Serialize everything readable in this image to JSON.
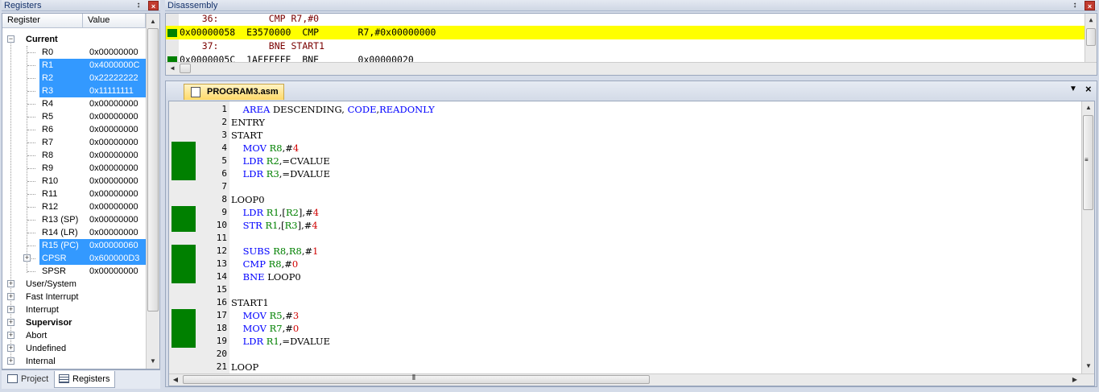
{
  "registers_panel": {
    "title": "Registers",
    "columns": [
      "Register",
      "Value"
    ],
    "current_label": "Current",
    "rows": [
      {
        "name": "R0",
        "value": "0x00000000",
        "selected": false
      },
      {
        "name": "R1",
        "value": "0x4000000C",
        "selected": true
      },
      {
        "name": "R2",
        "value": "0x22222222",
        "selected": true
      },
      {
        "name": "R3",
        "value": "0x11111111",
        "selected": true
      },
      {
        "name": "R4",
        "value": "0x00000000",
        "selected": false
      },
      {
        "name": "R5",
        "value": "0x00000000",
        "selected": false
      },
      {
        "name": "R6",
        "value": "0x00000000",
        "selected": false
      },
      {
        "name": "R7",
        "value": "0x00000000",
        "selected": false
      },
      {
        "name": "R8",
        "value": "0x00000000",
        "selected": false
      },
      {
        "name": "R9",
        "value": "0x00000000",
        "selected": false
      },
      {
        "name": "R10",
        "value": "0x00000000",
        "selected": false
      },
      {
        "name": "R11",
        "value": "0x00000000",
        "selected": false
      },
      {
        "name": "R12",
        "value": "0x00000000",
        "selected": false
      },
      {
        "name": "R13 (SP)",
        "value": "0x00000000",
        "selected": false
      },
      {
        "name": "R14 (LR)",
        "value": "0x00000000",
        "selected": false
      },
      {
        "name": "R15 (PC)",
        "value": "0x00000060",
        "selected": true
      },
      {
        "name": "CPSR",
        "value": "0x600000D3",
        "selected": true
      },
      {
        "name": "SPSR",
        "value": "0x00000000",
        "selected": false
      }
    ],
    "groups": [
      {
        "name": "User/System",
        "bold": false
      },
      {
        "name": "Fast Interrupt",
        "bold": false
      },
      {
        "name": "Interrupt",
        "bold": false
      },
      {
        "name": "Supervisor",
        "bold": true
      },
      {
        "name": "Abort",
        "bold": false
      },
      {
        "name": "Undefined",
        "bold": false
      },
      {
        "name": "Internal",
        "bold": false
      }
    ]
  },
  "bottom_tabs": [
    {
      "label": "Project",
      "active": false
    },
    {
      "label": "Registers",
      "active": true
    }
  ],
  "disassembly": {
    "title": "Disassembly",
    "lines": [
      {
        "text": "    36:         CMP R7,#0",
        "highlight": false,
        "marker": false
      },
      {
        "text": "0x00000058  E3570000  CMP       R7,#0x00000000",
        "highlight": true,
        "marker": true
      },
      {
        "text": "    37:         BNE START1",
        "highlight": false,
        "marker": false
      },
      {
        "text": "0x0000005C  1AFFFFFE  BNE       0x00000020",
        "highlight": false,
        "marker": true
      }
    ]
  },
  "editor": {
    "tab_label": "PROGRAM3.asm",
    "lines": [
      {
        "n": "1",
        "bp": false,
        "code": [
          [
            "    ",
            ""
          ],
          [
            "AREA",
            "kw"
          ],
          [
            " DESCENDING, ",
            ""
          ],
          [
            "CODE",
            "kw"
          ],
          [
            ",",
            ""
          ],
          [
            "READONLY",
            "kw"
          ]
        ]
      },
      {
        "n": "2",
        "bp": false,
        "code": [
          [
            "ENTRY",
            ""
          ]
        ]
      },
      {
        "n": "3",
        "bp": false,
        "code": [
          [
            "START",
            ""
          ]
        ]
      },
      {
        "n": "4",
        "bp": true,
        "code": [
          [
            "    ",
            ""
          ],
          [
            "MOV",
            "kw"
          ],
          [
            " ",
            ""
          ],
          [
            "R8",
            "reg"
          ],
          [
            ",#",
            ""
          ],
          [
            "4",
            "num"
          ]
        ]
      },
      {
        "n": "5",
        "bp": true,
        "code": [
          [
            "    ",
            ""
          ],
          [
            "LDR",
            "kw"
          ],
          [
            " ",
            ""
          ],
          [
            "R2",
            "reg"
          ],
          [
            ",=CVALUE",
            ""
          ]
        ]
      },
      {
        "n": "6",
        "bp": true,
        "code": [
          [
            "    ",
            ""
          ],
          [
            "LDR",
            "kw"
          ],
          [
            " ",
            ""
          ],
          [
            "R3",
            "reg"
          ],
          [
            ",=DVALUE",
            ""
          ]
        ]
      },
      {
        "n": "7",
        "bp": false,
        "code": []
      },
      {
        "n": "8",
        "bp": false,
        "code": [
          [
            "LOOP0",
            ""
          ]
        ]
      },
      {
        "n": "9",
        "bp": true,
        "code": [
          [
            "    ",
            ""
          ],
          [
            "LDR",
            "kw"
          ],
          [
            " ",
            ""
          ],
          [
            "R1",
            "reg"
          ],
          [
            ",[",
            ""
          ],
          [
            "R2",
            "reg"
          ],
          [
            "],#",
            ""
          ],
          [
            "4",
            "num"
          ]
        ]
      },
      {
        "n": "10",
        "bp": true,
        "code": [
          [
            "    ",
            ""
          ],
          [
            "STR",
            "kw"
          ],
          [
            " ",
            ""
          ],
          [
            "R1",
            "reg"
          ],
          [
            ",[",
            ""
          ],
          [
            "R3",
            "reg"
          ],
          [
            "],#",
            ""
          ],
          [
            "4",
            "num"
          ]
        ]
      },
      {
        "n": "11",
        "bp": false,
        "code": []
      },
      {
        "n": "12",
        "bp": true,
        "code": [
          [
            "    ",
            ""
          ],
          [
            "SUBS",
            "kw"
          ],
          [
            " ",
            ""
          ],
          [
            "R8",
            "reg"
          ],
          [
            ",",
            ""
          ],
          [
            "R8",
            "reg"
          ],
          [
            ",#",
            ""
          ],
          [
            "1",
            "num"
          ]
        ]
      },
      {
        "n": "13",
        "bp": true,
        "code": [
          [
            "    ",
            ""
          ],
          [
            "CMP",
            "kw"
          ],
          [
            " ",
            ""
          ],
          [
            "R8",
            "reg"
          ],
          [
            ",#",
            ""
          ],
          [
            "0",
            "num"
          ]
        ]
      },
      {
        "n": "14",
        "bp": true,
        "code": [
          [
            "    ",
            ""
          ],
          [
            "BNE",
            "kw"
          ],
          [
            " LOOP0",
            ""
          ]
        ]
      },
      {
        "n": "15",
        "bp": false,
        "code": []
      },
      {
        "n": "16",
        "bp": false,
        "code": [
          [
            "START1",
            ""
          ]
        ]
      },
      {
        "n": "17",
        "bp": true,
        "code": [
          [
            "    ",
            ""
          ],
          [
            "MOV",
            "kw"
          ],
          [
            " ",
            ""
          ],
          [
            "R5",
            "reg"
          ],
          [
            ",#",
            ""
          ],
          [
            "3",
            "num"
          ]
        ]
      },
      {
        "n": "18",
        "bp": true,
        "code": [
          [
            "    ",
            ""
          ],
          [
            "MOV",
            "kw"
          ],
          [
            " ",
            ""
          ],
          [
            "R7",
            "reg"
          ],
          [
            ",#",
            ""
          ],
          [
            "0",
            "num"
          ]
        ]
      },
      {
        "n": "19",
        "bp": true,
        "code": [
          [
            "    ",
            ""
          ],
          [
            "LDR",
            "kw"
          ],
          [
            " ",
            ""
          ],
          [
            "R1",
            "reg"
          ],
          [
            ",=DVALUE",
            ""
          ]
        ]
      },
      {
        "n": "20",
        "bp": false,
        "code": []
      },
      {
        "n": "21",
        "bp": false,
        "code": [
          [
            "LOOP",
            ""
          ]
        ]
      }
    ]
  },
  "icons": {
    "pin": "pin-icon",
    "close": "close-icon",
    "collapse": "minus",
    "expand": "plus"
  },
  "colors": {
    "selection": "#3399ff",
    "current_line": "#ffff00",
    "breakpoint_gutter": "#008000",
    "keyword": "#0000ff",
    "number": "#d00000",
    "register": "#008000"
  }
}
